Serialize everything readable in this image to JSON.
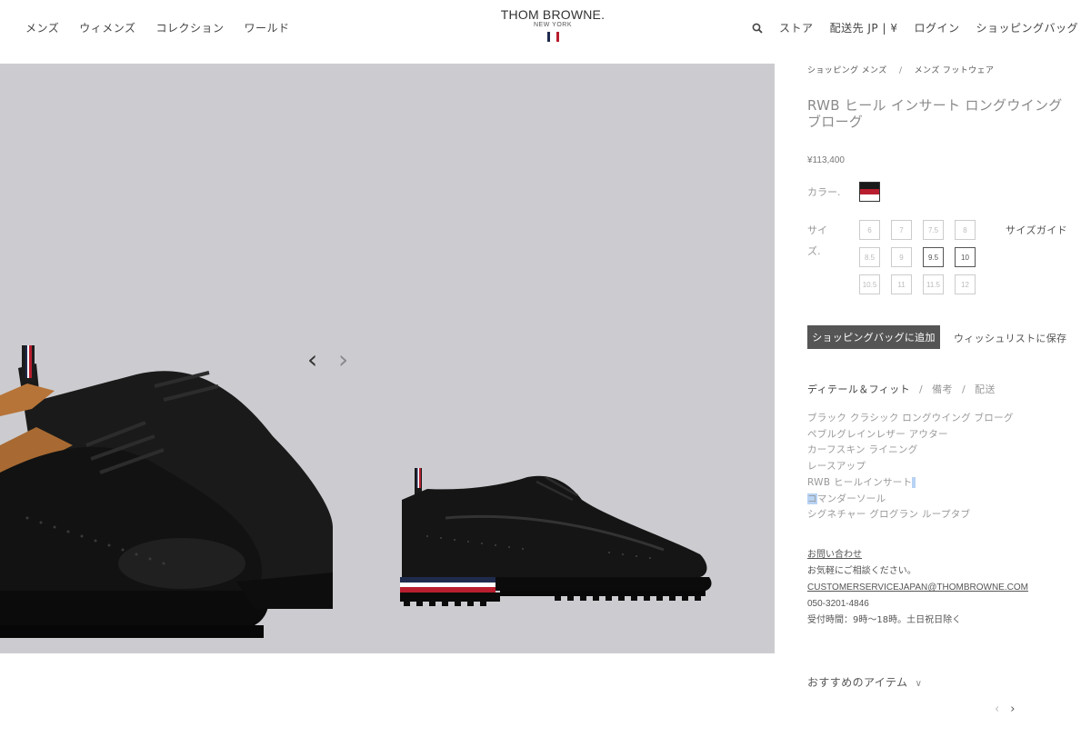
{
  "header": {
    "nav_left": [
      "メンズ",
      "ウィメンズ",
      "コレクション",
      "ワールド"
    ],
    "logo_main": "THOM BROWNE.",
    "logo_sub": "NEW YORK",
    "nav_right": {
      "store": "ストア",
      "ship_to": "配送先 JP | ¥",
      "login": "ログイン",
      "bag": "ショッピングバッグ"
    },
    "flag_colors": [
      "#1f2b4d",
      "#ffffff",
      "#b81e2e"
    ]
  },
  "gallery": {
    "prev_arrow": "‹",
    "next_arrow": "›",
    "background": "#ccccd0"
  },
  "product": {
    "breadcrumb": [
      "ショッピング メンズ",
      "メンズ フットウェア"
    ],
    "breadcrumb_sep": "/",
    "title": "RWB ヒール インサート ロングウイング ブローグ",
    "price": "¥113,400",
    "color_label": "カラー.",
    "size_label": "サイズ.",
    "sizes": [
      "6",
      "7",
      "7.5",
      "8",
      "8.5",
      "9",
      "9.5",
      "10",
      "10.5",
      "11",
      "11.5",
      "12"
    ],
    "available_sizes": [
      "9.5",
      "10"
    ],
    "size_guide": "サイズガイド",
    "add_to_bag": "ショッピングバッグに追加",
    "wishlist": "ウィッシュリストに保存",
    "tabs": [
      "ディテール＆フィット",
      "備考",
      "配送"
    ],
    "details": [
      "ブラック クラシック ロングウイング ブローグ",
      "ペブルグレインレザー アウター",
      "カーフスキン ライニング",
      "レースアップ",
      "RWB ヒールインサート",
      "コマンダーソール",
      "シグネチャー グログラン ループタブ"
    ]
  },
  "contact": {
    "title": "お問い合わせ",
    "desc": "お気軽にご相談ください。",
    "email": "CUSTOMERSERVICEJAPAN@THOMBROWNE.COM",
    "phone": "050-3201-4846",
    "hours": "受付時間：9時〜18時。土日祝日除く"
  },
  "recommend": {
    "label": "おすすめのアイテム",
    "chevron": "∨",
    "prev": "‹",
    "next": "›"
  }
}
